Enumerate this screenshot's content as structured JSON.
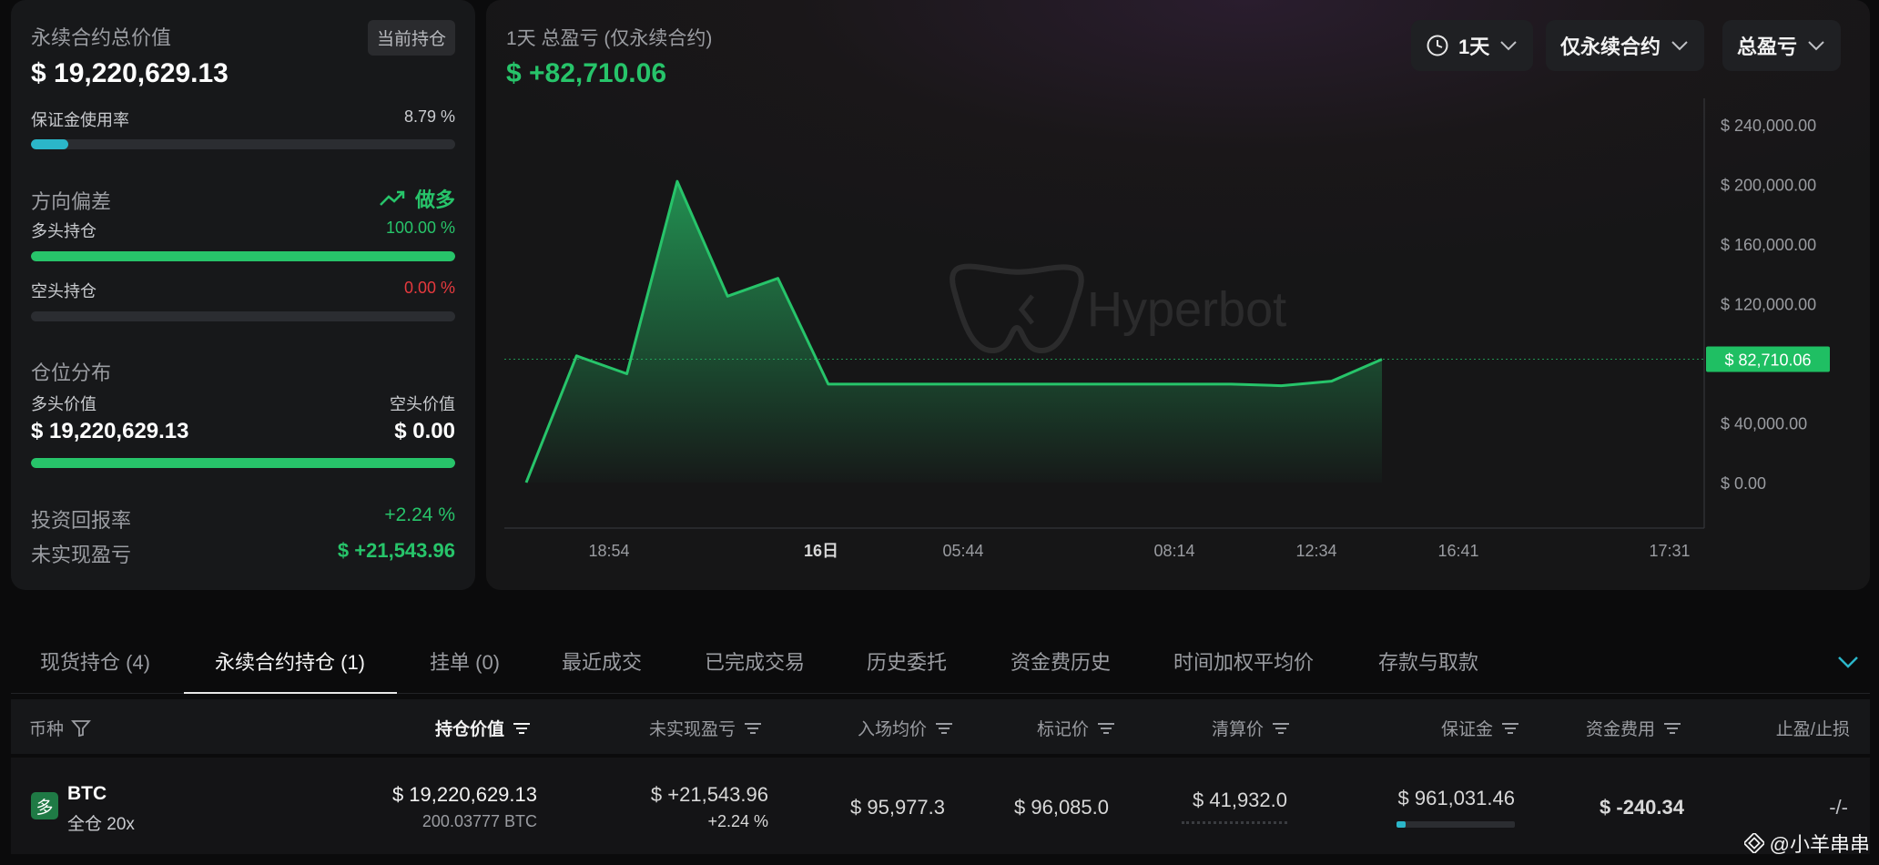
{
  "summary": {
    "title": "永续合约总价值",
    "badge": "当前持仓",
    "total_value": "$ 19,220,629.13",
    "margin_usage_label": "保证金使用率",
    "margin_usage_value": "8.79 %",
    "margin_usage_fraction": 0.0879,
    "direction_label": "方向偏差",
    "direction_value": "做多",
    "long_label": "多头持仓",
    "long_pct": "100.00 %",
    "long_fraction": 1.0,
    "short_label": "空头持仓",
    "short_pct": "0.00 %",
    "short_fraction": 0.0,
    "distribution_label": "仓位分布",
    "long_value_label": "多头价值",
    "short_value_label": "空头价值",
    "long_value": "$ 19,220,629.13",
    "short_value": "$ 0.00",
    "roi_label": "投资回报率",
    "roi_value": "+2.24 %",
    "unrealized_label": "未实现盈亏",
    "unrealized_value": "$ +21,543.96"
  },
  "chart_header": {
    "title": "1天 总盈亏 (仅永续合约)",
    "value": "$ +82,710.06",
    "period": "1天",
    "scope": "仅永续合约",
    "metric": "总盈亏",
    "watermark": "Hyperbot"
  },
  "chart_data": {
    "type": "area",
    "x_ticks": [
      "18:54",
      "16日",
      "05:44",
      "08:14",
      "12:34",
      "16:41",
      "17:31"
    ],
    "y_ticks": [
      "$ 240,000.00",
      "$ 200,000.00",
      "$ 160,000.00",
      "$ 120,000.00",
      "$ 40,000.00",
      "$ 0.00"
    ],
    "current_label": "$ 82,710.06",
    "current_value": 82710.06,
    "ylim": [
      0,
      240000
    ],
    "series": [
      {
        "values": [
          0,
          85000,
          73000,
          202000,
          125000,
          137000,
          66000,
          66000,
          66000,
          66000,
          66000,
          66000,
          66000,
          66000,
          66000,
          65000,
          68000,
          82710
        ]
      }
    ],
    "color": "#27c46a"
  },
  "tabs": [
    {
      "label": "现货持仓 (4)"
    },
    {
      "label": "永续合约持仓 (1)"
    },
    {
      "label": "挂单 (0)"
    },
    {
      "label": "最近成交"
    },
    {
      "label": "已完成交易"
    },
    {
      "label": "历史委托"
    },
    {
      "label": "资金费历史"
    },
    {
      "label": "时间加权平均价"
    },
    {
      "label": "存款与取款"
    }
  ],
  "table": {
    "headers": [
      "币种",
      "持仓价值",
      "未实现盈亏",
      "入场均价",
      "标记价",
      "清算价",
      "保证金",
      "资金费用",
      "止盈/止损"
    ],
    "row": {
      "side_badge": "多",
      "coin": "BTC",
      "leverage": "全仓 20x",
      "position_value": "$ 19,220,629.13",
      "position_size": "200.03777 BTC",
      "unrealized": "$ +21,543.96",
      "unrealized_pct": "+2.24 %",
      "entry_price": "$ 95,977.3",
      "mark_price": "$ 96,085.0",
      "liq_price": "$ 41,932.0",
      "margin": "$ 961,031.46",
      "margin_fraction": 0.08,
      "funding": "$ -240.34",
      "tpsl": "-/-"
    }
  },
  "watermark_footer": "@小羊串串"
}
